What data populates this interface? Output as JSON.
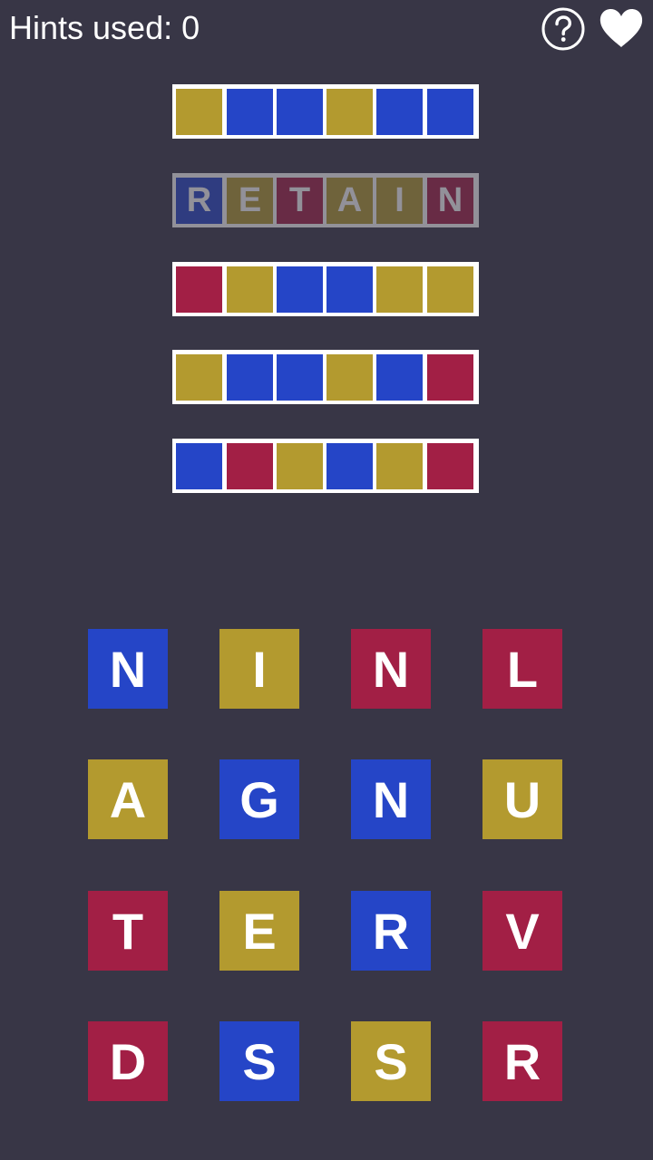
{
  "header": {
    "hints_label": "Hints used: 0",
    "help_icon": "help-circle-icon",
    "heart_icon": "heart-icon"
  },
  "colors": {
    "background": "#383646",
    "blue": "#2545c7",
    "gold": "#b39a2f",
    "red": "#a21f45",
    "frame": "#ffffff"
  },
  "word_rows": [
    {
      "letters": [
        "",
        "",
        "",
        "",
        "",
        ""
      ],
      "colors": [
        "gold",
        "blue",
        "blue",
        "gold",
        "blue",
        "blue"
      ],
      "dimmed": false
    },
    {
      "letters": [
        "R",
        "E",
        "T",
        "A",
        "I",
        "N"
      ],
      "colors": [
        "blue",
        "gold",
        "red",
        "gold",
        "gold",
        "red"
      ],
      "dimmed": true
    },
    {
      "letters": [
        "",
        "",
        "",
        "",
        "",
        ""
      ],
      "colors": [
        "red",
        "gold",
        "blue",
        "blue",
        "gold",
        "gold"
      ],
      "dimmed": false
    },
    {
      "letters": [
        "",
        "",
        "",
        "",
        "",
        ""
      ],
      "colors": [
        "gold",
        "blue",
        "blue",
        "gold",
        "blue",
        "red"
      ],
      "dimmed": false
    },
    {
      "letters": [
        "",
        "",
        "",
        "",
        "",
        ""
      ],
      "colors": [
        "blue",
        "red",
        "gold",
        "blue",
        "gold",
        "red"
      ],
      "dimmed": false
    }
  ],
  "tiles": [
    [
      {
        "letter": "N",
        "color": "blue"
      },
      {
        "letter": "I",
        "color": "gold"
      },
      {
        "letter": "N",
        "color": "red"
      },
      {
        "letter": "L",
        "color": "red"
      }
    ],
    [
      {
        "letter": "A",
        "color": "gold"
      },
      {
        "letter": "G",
        "color": "blue"
      },
      {
        "letter": "N",
        "color": "blue"
      },
      {
        "letter": "U",
        "color": "gold"
      }
    ],
    [
      {
        "letter": "T",
        "color": "red"
      },
      {
        "letter": "E",
        "color": "gold"
      },
      {
        "letter": "R",
        "color": "blue"
      },
      {
        "letter": "V",
        "color": "red"
      }
    ],
    [
      {
        "letter": "D",
        "color": "red"
      },
      {
        "letter": "S",
        "color": "blue"
      },
      {
        "letter": "S",
        "color": "gold"
      },
      {
        "letter": "R",
        "color": "red"
      }
    ]
  ]
}
